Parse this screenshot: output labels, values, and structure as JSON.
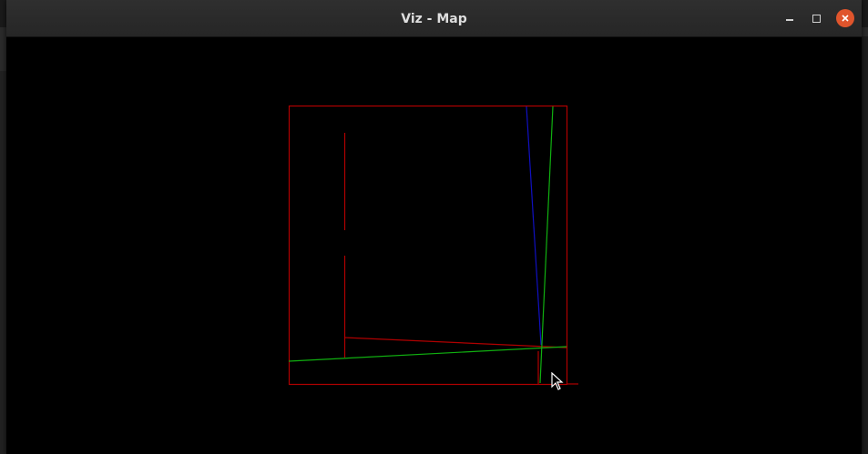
{
  "window": {
    "title": "Viz - Map"
  },
  "titlebar_buttons": {
    "minimize_icon": "minimize-icon",
    "maximize_icon": "maximize-icon",
    "close_icon": "close-icon"
  },
  "colors": {
    "boundary": "#b00000",
    "blue_line": "#1010c0",
    "green_line": "#10b010",
    "close_button": "#e0552c",
    "titlebar": "#2c2c2c"
  }
}
